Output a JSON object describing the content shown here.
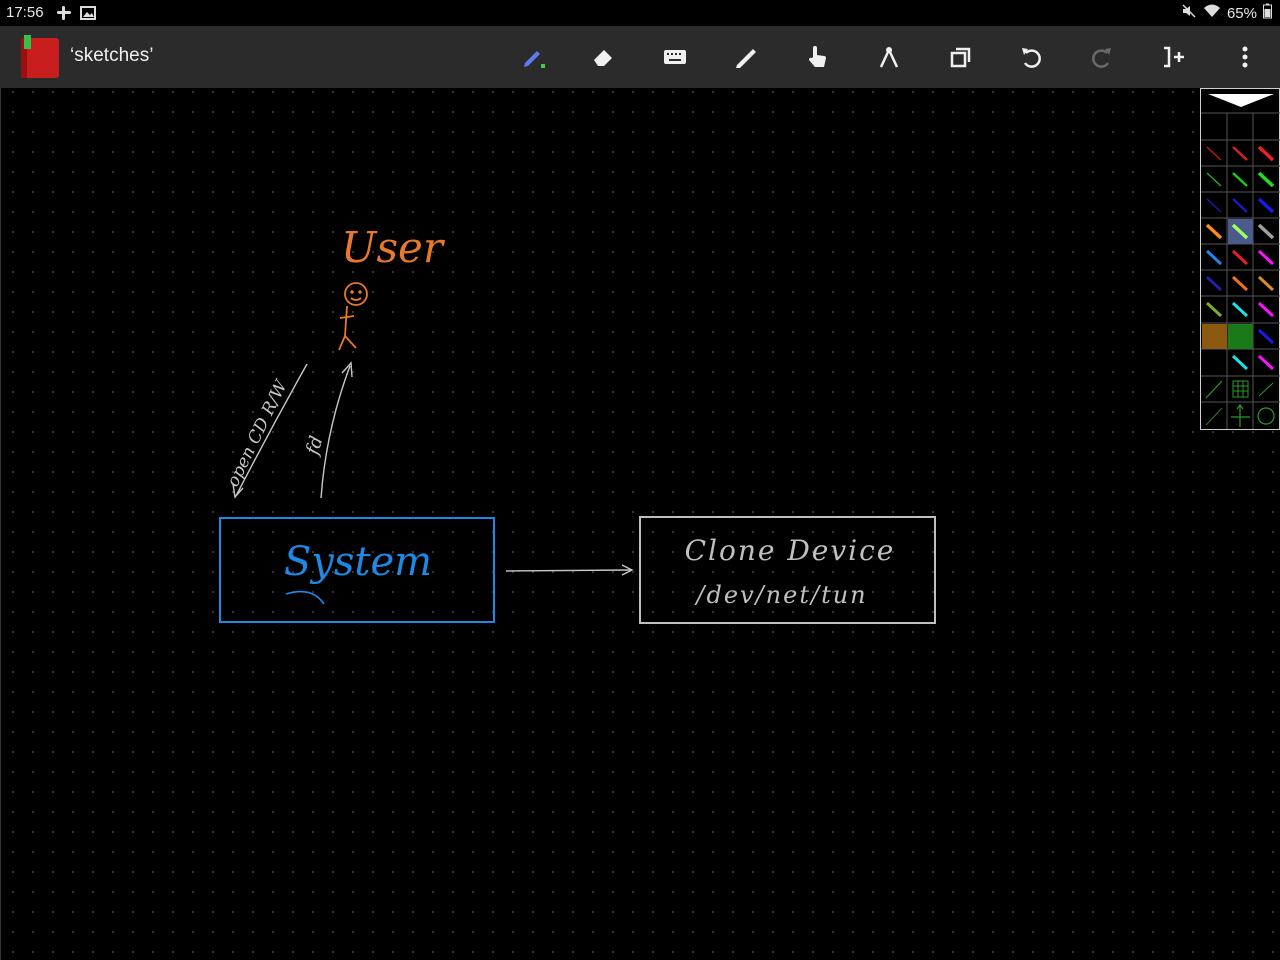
{
  "status_bar": {
    "time": "17:56",
    "battery": "65%",
    "left_icons": [
      "slack-icon",
      "image-icon"
    ],
    "right_icons": [
      "mute-icon",
      "wifi-icon",
      "battery-icon"
    ]
  },
  "app_bar": {
    "notebook_title": "‘sketches’",
    "tools": [
      "pen-icon",
      "eraser-icon",
      "keyboard-icon",
      "highlighter-icon",
      "hand-icon",
      "compass-icon",
      "copy-icon",
      "undo-icon",
      "redo-icon",
      "insert-page-icon",
      "more-vert-icon"
    ],
    "active_tool": "pen-icon",
    "redo_enabled": false
  },
  "sketch": {
    "handwritten_text": [
      "User",
      "open CD R/W",
      "fd",
      "System",
      "Clone Device",
      "/dev/net/tun"
    ],
    "colors": {
      "user": "#e8782a",
      "system": "#1e88e5",
      "device": "#c0c0c0",
      "arrows": "#c8c8c8"
    }
  },
  "palette": {
    "selected_cell": "row4-col2",
    "colors": [
      "#d32020",
      "#1ec81e",
      "#1a1ad8",
      "#ff8c1a",
      "#a0a0a0",
      "#1e88e5",
      "#ff10ff",
      "#8b5a10",
      "#1a7a1a",
      "#20e0e0"
    ]
  }
}
